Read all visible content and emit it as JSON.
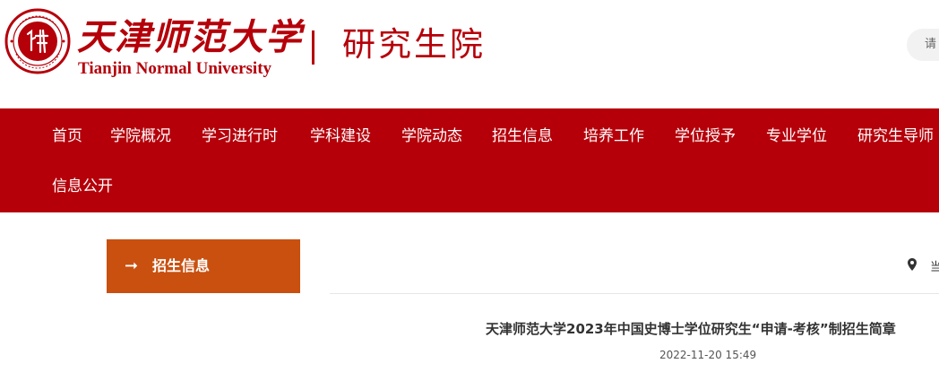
{
  "header": {
    "university_name_cn": "天津师范大学",
    "university_name_en": "Tianjin Normal University",
    "department": "研究生院",
    "brand_color": "#b5000a",
    "search_placeholder": "请"
  },
  "nav": {
    "items": [
      {
        "label": "首页"
      },
      {
        "label": "学院概况"
      },
      {
        "label": "学习进行时"
      },
      {
        "label": "学科建设"
      },
      {
        "label": "学院动态"
      },
      {
        "label": "招生信息"
      },
      {
        "label": "培养工作"
      },
      {
        "label": "学位授予"
      },
      {
        "label": "专业学位"
      },
      {
        "label": "研究生导师"
      },
      {
        "label": "信息公开"
      }
    ]
  },
  "sidebar": {
    "heading": "招生信息",
    "arrow": "➞",
    "accent_color": "#c9500f"
  },
  "breadcrumb": {
    "icon": "location-pin-icon",
    "text": "当"
  },
  "article": {
    "title": "天津师范大学2023年中国史博士学位研究生“申请-考核”制招生简章",
    "date": "2022-11-20 15:49"
  }
}
